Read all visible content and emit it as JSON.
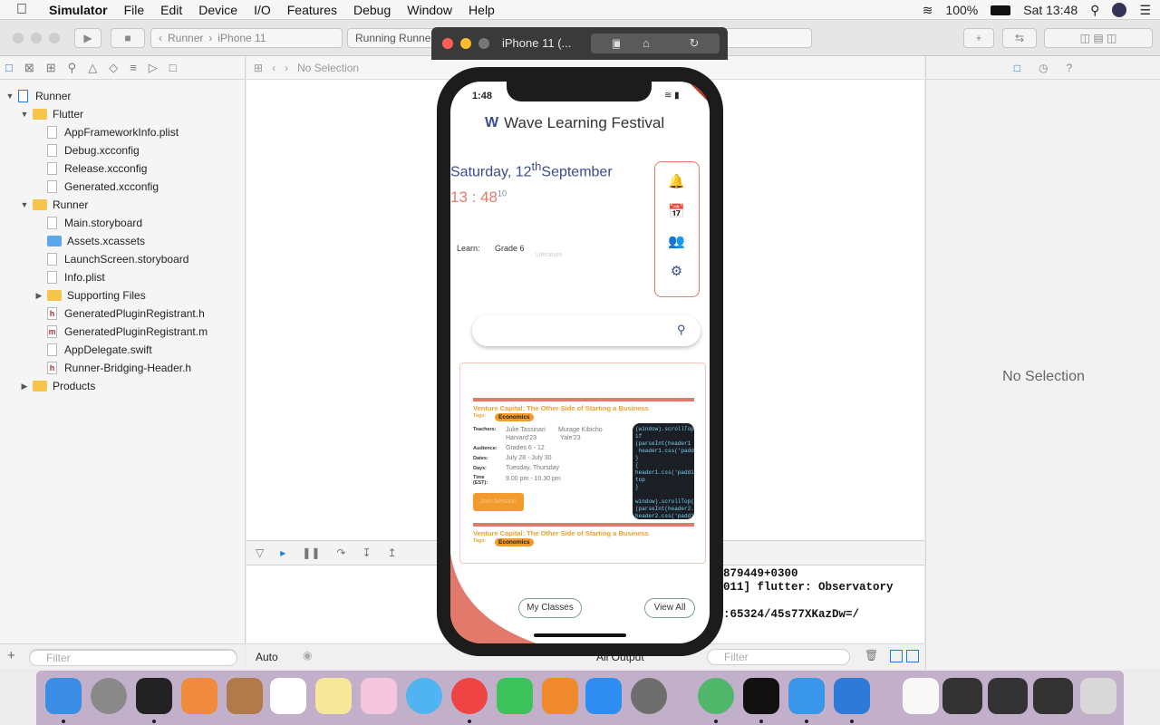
{
  "menubar": {
    "app": "Simulator",
    "items": [
      "File",
      "Edit",
      "Device",
      "I/O",
      "Features",
      "Debug",
      "Window",
      "Help"
    ],
    "battery": "100%",
    "clock": "Sat 13:48"
  },
  "xcode": {
    "scheme_target": "Runner",
    "scheme_device": "iPhone 11",
    "status": "Running Runner",
    "jump": "No Selection",
    "inspector_empty": "No Selection",
    "filter_placeholder": "Filter",
    "auto_label": "Auto",
    "output_label": "All Output"
  },
  "tree": [
    {
      "label": "Runner",
      "level": 0,
      "kind": "proj",
      "open": true
    },
    {
      "label": "Flutter",
      "level": 1,
      "kind": "folder",
      "open": true
    },
    {
      "label": "AppFrameworkInfo.plist",
      "level": 2,
      "kind": "file",
      "glyph": ""
    },
    {
      "label": "Debug.xcconfig",
      "level": 2,
      "kind": "file",
      "glyph": ""
    },
    {
      "label": "Release.xcconfig",
      "level": 2,
      "kind": "file",
      "glyph": ""
    },
    {
      "label": "Generated.xcconfig",
      "level": 2,
      "kind": "file",
      "glyph": ""
    },
    {
      "label": "Runner",
      "level": 1,
      "kind": "folder",
      "open": true
    },
    {
      "label": "Main.storyboard",
      "level": 2,
      "kind": "file",
      "glyph": ""
    },
    {
      "label": "Assets.xcassets",
      "level": 2,
      "kind": "assets",
      "glyph": ""
    },
    {
      "label": "LaunchScreen.storyboard",
      "level": 2,
      "kind": "file",
      "glyph": ""
    },
    {
      "label": "Info.plist",
      "level": 2,
      "kind": "file",
      "glyph": ""
    },
    {
      "label": "Supporting Files",
      "level": 2,
      "kind": "folder",
      "open": false
    },
    {
      "label": "GeneratedPluginRegistrant.h",
      "level": 2,
      "kind": "file",
      "glyph": "h"
    },
    {
      "label": "GeneratedPluginRegistrant.m",
      "level": 2,
      "kind": "file",
      "glyph": "m"
    },
    {
      "label": "AppDelegate.swift",
      "level": 2,
      "kind": "file",
      "glyph": ""
    },
    {
      "label": "Runner-Bridging-Header.h",
      "level": 2,
      "kind": "file",
      "glyph": "h"
    },
    {
      "label": "Products",
      "level": 1,
      "kind": "folder",
      "open": false
    }
  ],
  "console_lines": [
    "879449+0300",
    "011] flutter: Observatory",
    "",
    ":65324/45s77XKazDw=/"
  ],
  "simulator": {
    "title": "iPhone 11 (...",
    "debug_banner": "DEBUG"
  },
  "app": {
    "status_time": "1:48",
    "brand": "Wave Learning Festival",
    "date_prefix": "Saturday, 12",
    "date_sup": "th",
    "date_month": "September",
    "time_hm": "13 : 48",
    "time_sec": "10",
    "learn_label": "Learn:",
    "grade": "Grade 6",
    "subject": "Literature",
    "cards": [
      {
        "title": "Venture Capital: The Other Side of Starting a Business",
        "tags_label": "Tags:",
        "tag": "Economics",
        "teachers_label": "Teachers:",
        "teacher1": "Julie Tassinari",
        "teacher1_school": "Harvard'23",
        "teacher2": "Murage Kibicho",
        "teacher2_school": "Yale'23",
        "audience_label": "Audience:",
        "audience": "Grades 6 - 12",
        "dates_label": "Dates:",
        "dates": "July 28 - July 30",
        "days_label": "Days:",
        "days": "Tuesday, Thursday",
        "time_label": "Time (EST):",
        "time": "9.00 pm - 10.30 pm",
        "button": "Join Session"
      },
      {
        "title": "Venture Capital: The Other Side of Starting a Business",
        "tags_label": "Tags:",
        "tag": "Economics"
      }
    ],
    "my_classes": "My Classes",
    "view_all": "View All"
  },
  "colors": {
    "accent": "#e3796a",
    "brand_blue": "#3a4c8f",
    "tag_orange": "#f39a2c"
  }
}
